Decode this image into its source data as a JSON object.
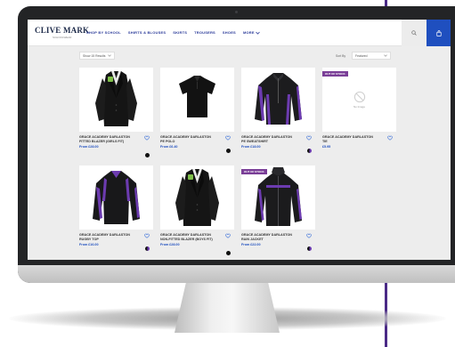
{
  "header": {
    "logo": "CLIVE MARK",
    "logo_sub": "SCHOOLWEAR",
    "nav": [
      "SHOP BY SCHOOL",
      "SHIRTS & BLOUSES",
      "SKIRTS",
      "TROUSERS",
      "SHOES",
      "MORE"
    ],
    "icons": {
      "search": "search-icon",
      "cart": "bag-icon",
      "more": "chevron-down-icon"
    },
    "cart_color": "#1f4fbf"
  },
  "toolbar": {
    "show_results": "Show 15 Results",
    "sort_label": "Sort By",
    "sort_value": "Featured"
  },
  "products": [
    {
      "name": "GRACE ACADEMY DARLASTON FITTED BLAZER (GIRLS FIT)",
      "price": "From £28.00",
      "badge": "",
      "image": "blazer-icon",
      "swatch": "black"
    },
    {
      "name": "GRACE ACADEMY DARLASTON PE POLO",
      "price": "From £6.40",
      "badge": "",
      "image": "polo-icon",
      "swatch": "black"
    },
    {
      "name": "GRACE ACADEMY DARLASTON PE SWEATSHIRT",
      "price": "From £18.00",
      "badge": "",
      "image": "sweatshirt-icon",
      "swatch": "black-purple"
    },
    {
      "name": "GRACE ACADEMY DARLASTON TIE",
      "price": "£5.95",
      "badge": "OUT OF STOCK",
      "image": "no-image-icon",
      "placeholder": "No Image",
      "swatch": ""
    },
    {
      "name": "GRACE ACADEMY DARLASTON RUGBY TOP",
      "price": "From £16.00",
      "badge": "",
      "image": "rugby-top-icon",
      "swatch": "black-purple"
    },
    {
      "name": "GRACE ACADEMY DARLASTON NON-FITTED BLAZER (BOYS FIT)",
      "price": "From £28.00",
      "badge": "",
      "image": "blazer-icon",
      "swatch": "black"
    },
    {
      "name": "GRACE ACADEMY DARLASTON RAIN JACKET",
      "price": "From £22.00",
      "badge": "OUT OF STOCK",
      "image": "rain-jacket-icon",
      "swatch": "black-purple"
    }
  ],
  "colors": {
    "accent_purple": "#7a3e97",
    "price_blue": "#1f4fbf",
    "frame_line": "#4a2a86"
  }
}
